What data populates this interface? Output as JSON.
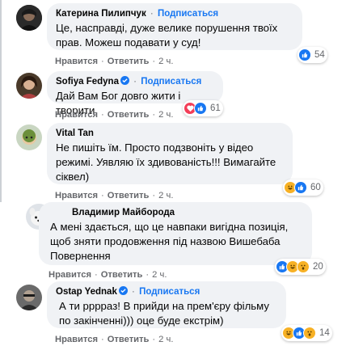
{
  "colors": {
    "bubble": "#f0f2f5",
    "accent": "#1877f2",
    "muted": "#65676b"
  },
  "comments": [
    {
      "author": "Катерина Пилипчук",
      "follow": "Подписаться",
      "verified": false,
      "text": "Це, насправді, дуже велике порушення твоїх прав. Можеш подавати у суд!",
      "like": "Нравится",
      "reply": "Ответить",
      "time": "2 ч.",
      "reactions": [
        "like"
      ],
      "count": "54"
    },
    {
      "author": "Sofiya Fedyna",
      "follow": "Подписаться",
      "verified": true,
      "text": "Дай Вам Бог довго жити і творити",
      "like": "Нравится",
      "reply": "Ответить",
      "time": "2 ч.",
      "reactions": [
        "love",
        "like"
      ],
      "count": "61"
    },
    {
      "author": "Vital Tan",
      "follow": "",
      "verified": false,
      "text": "Не пишіть їм. Просто подзвоніть у відео режимі. Уявляю їх здивованість!!! Вимагайте сіквел)",
      "like": "Нравится",
      "reply": "Ответить",
      "time": "2 ч.",
      "reactions": [
        "haha",
        "like"
      ],
      "count": "60"
    },
    {
      "author": "Владимир Майборода",
      "follow": "",
      "verified": false,
      "text": "А мені здається, що це навпаки вигідна позиція, щоб зняти продовження під назвою Вишебаба Повернення",
      "like": "Нравится",
      "reply": "Ответить",
      "time": "2 ч.",
      "reactions": [
        "like",
        "haha",
        "haha"
      ],
      "count": "20"
    },
    {
      "author": "Ostap Yednak",
      "follow": "Подписаться",
      "verified": true,
      "text": "А ти ррррaз! В прийди на прем'єру фільму по закінченні))) оце буде екстрім)",
      "like": "Нравится",
      "reply": "Ответить",
      "time": "2 ч.",
      "reactions": [
        "haha",
        "like",
        "haha"
      ],
      "count": "14"
    }
  ]
}
